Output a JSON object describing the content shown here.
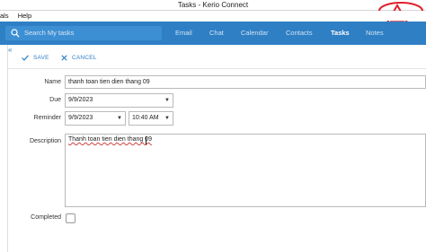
{
  "window": {
    "title": "Tasks - Kerio Connect"
  },
  "menu": {
    "items": [
      "als",
      "Help"
    ]
  },
  "search": {
    "placeholder": "Search My tasks"
  },
  "nav": {
    "tabs": [
      "Email",
      "Chat",
      "Calendar",
      "Contacts",
      "Tasks",
      "Notes"
    ],
    "active": "Tasks"
  },
  "toolbar": {
    "save_label": "SAVE",
    "cancel_label": "CANCEL"
  },
  "form": {
    "name_label": "Name",
    "name_value": "thanh toan tien dien thang 09",
    "due_label": "Due",
    "due_value": "9/9/2023",
    "reminder_label": "Reminder",
    "reminder_date": "9/9/2023",
    "reminder_time": "10:40 AM",
    "description_label": "Description",
    "description_value": "Thanh toan tien dien thang 09",
    "completed_label": "Completed",
    "completed_checked": false
  },
  "colors": {
    "nav_bar": "#2f7fc4",
    "accent": "#2f7fc4",
    "watermark": "#e0202a"
  },
  "icons": {
    "search": "search-icon",
    "save": "check-icon",
    "cancel": "close-icon",
    "collapse": "double-chevron-left-icon"
  }
}
